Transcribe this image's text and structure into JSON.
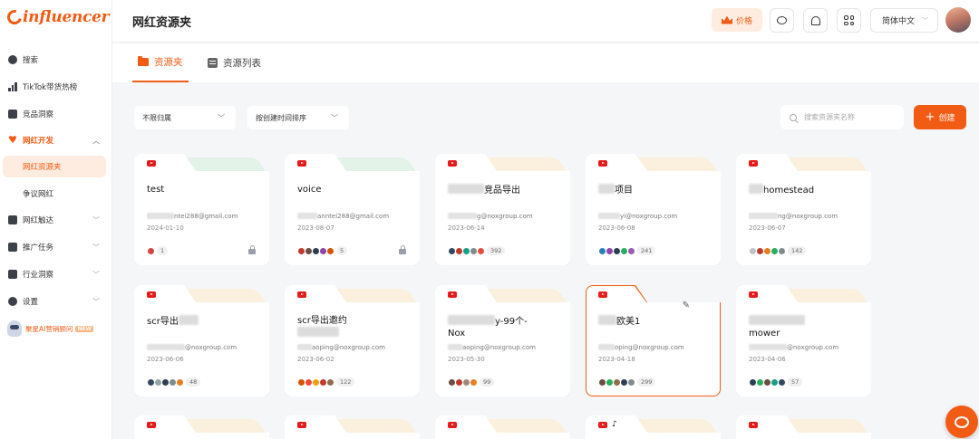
{
  "brand": {
    "logo": "influencer",
    "accent": "#f25b14"
  },
  "sidebar": {
    "items": [
      {
        "label": "搜索",
        "icon": "search-icon"
      },
      {
        "label": "TikTok带货热榜",
        "icon": "bar-chart-icon"
      },
      {
        "label": "竞品洞察",
        "icon": "shield-icon"
      },
      {
        "label": "网红开发",
        "icon": "heart-icon"
      },
      {
        "label": "网红触达",
        "icon": "mail-icon"
      },
      {
        "label": "推广任务",
        "icon": "document-icon"
      },
      {
        "label": "行业洞察",
        "icon": "monitor-icon"
      },
      {
        "label": "设置",
        "icon": "gear-icon"
      }
    ],
    "sub_items": [
      {
        "label": "网红资源夹"
      },
      {
        "label": "争议网红"
      }
    ],
    "ai": {
      "label": "聚星AI营销顾问",
      "badge": "NEW"
    }
  },
  "header": {
    "title": "网红资源夹",
    "price_label": "价格",
    "language": "简体中文"
  },
  "tabs": [
    {
      "label": "资源夹"
    },
    {
      "label": "资源列表"
    }
  ],
  "filters": {
    "owner": "不限归属",
    "sort": "按创建时间排序",
    "search_placeholder": "搜索资源夹名称",
    "create_label": "创建"
  },
  "cards": [
    {
      "name": "test",
      "email": "ntei288@gmail.com",
      "date": "2024-01-10",
      "count": "1",
      "locked": true,
      "tab": "green"
    },
    {
      "name": "voice",
      "email": "anntei288@gmail.com",
      "date": "2023-08-07",
      "count": "5",
      "locked": true,
      "tab": "green"
    },
    {
      "name": "竞品导出",
      "email": "g@noxgroup.com",
      "date": "2023-06-14",
      "count": "392",
      "locked": false,
      "tab": "cream"
    },
    {
      "name": "项目",
      "email": "yi@noxgroup.com",
      "date": "2023-06-08",
      "count": "241",
      "locked": false,
      "tab": "cream"
    },
    {
      "name": "homestead",
      "email": "ng@noxgroup.com",
      "date": "2023-06-07",
      "count": "142",
      "locked": false,
      "tab": "cream"
    },
    {
      "name": "scr导出",
      "email": "@noxgroup.com",
      "date": "2023-06-06",
      "count": "48",
      "locked": false,
      "tab": "cream"
    },
    {
      "name": "scr导出邀约",
      "email": "aoping@noxgroup.com",
      "date": "2023-06-02",
      "count": "122",
      "locked": false,
      "tab": "cream"
    },
    {
      "name": "y-99个-",
      "name2": "Nox",
      "email": "aoping@noxgroup.com",
      "date": "2023-05-30",
      "count": "99",
      "locked": false,
      "tab": "cream"
    },
    {
      "name": "欧美1",
      "email": "oping@noxgroup.com",
      "date": "2023-04-18",
      "count": "299",
      "locked": false,
      "tab": "cream"
    },
    {
      "name": "mower",
      "email": "@noxgroup.com",
      "date": "2023-04-06",
      "count": "57",
      "locked": false,
      "tab": "cream"
    }
  ]
}
